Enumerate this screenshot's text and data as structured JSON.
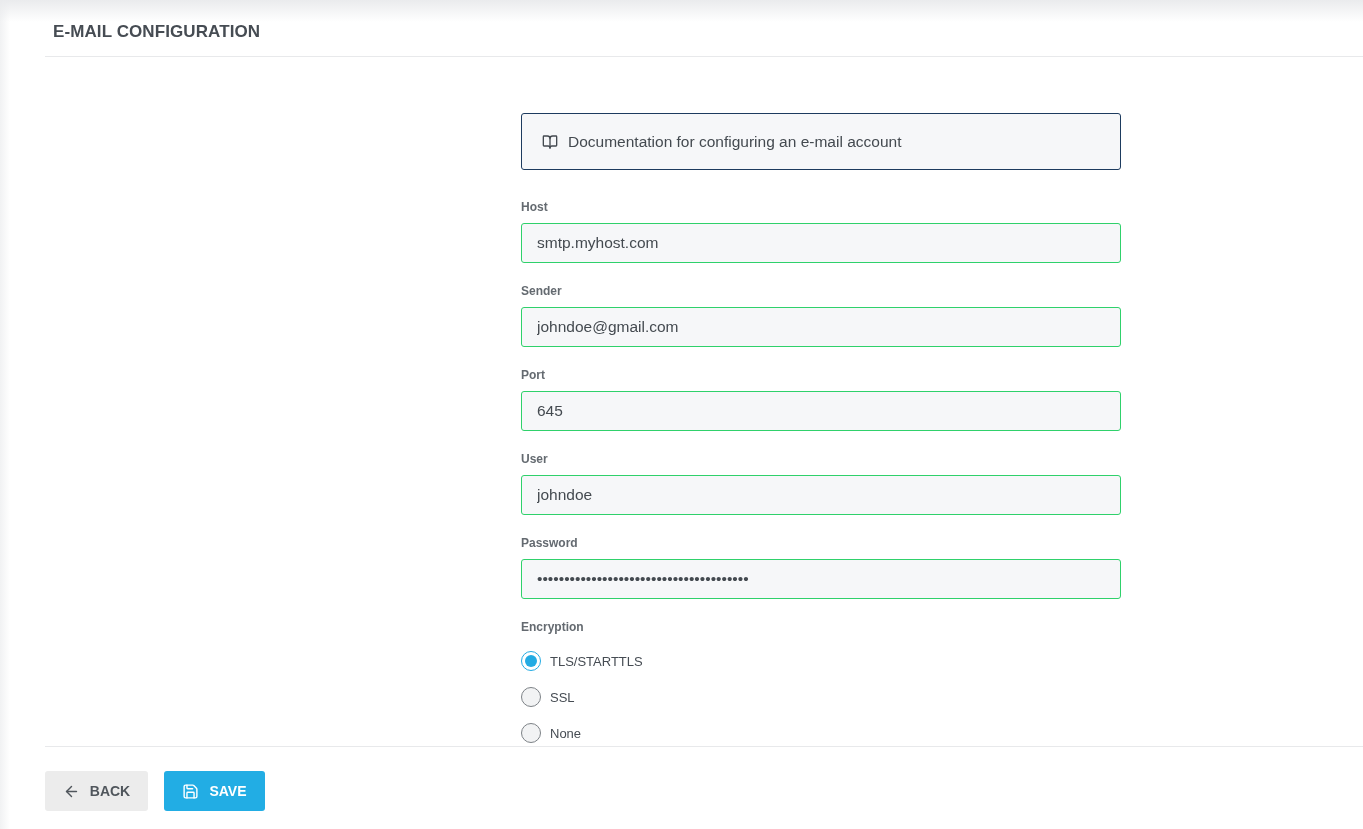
{
  "header": {
    "title": "E-MAIL CONFIGURATION"
  },
  "documentation_link": {
    "label": "Documentation for configuring an e-mail account"
  },
  "fields": [
    {
      "label": "Host",
      "value": "smtp.myhost.com"
    },
    {
      "label": "Sender",
      "value": "johndoe@gmail.com"
    },
    {
      "label": "Port",
      "value": "645"
    },
    {
      "label": "User",
      "value": "johndoe"
    },
    {
      "label": "Password",
      "value": "•••••••••••••••••••••••••••••••••••••••"
    }
  ],
  "encryption": {
    "label": "Encryption",
    "options": [
      {
        "label": "TLS/STARTTLS",
        "selected": true
      },
      {
        "label": "SSL",
        "selected": false
      },
      {
        "label": "None",
        "selected": false
      }
    ]
  },
  "footer": {
    "buttons": [
      {
        "label": "BACK",
        "kind": "back"
      },
      {
        "label": "SAVE",
        "kind": "save"
      }
    ]
  }
}
